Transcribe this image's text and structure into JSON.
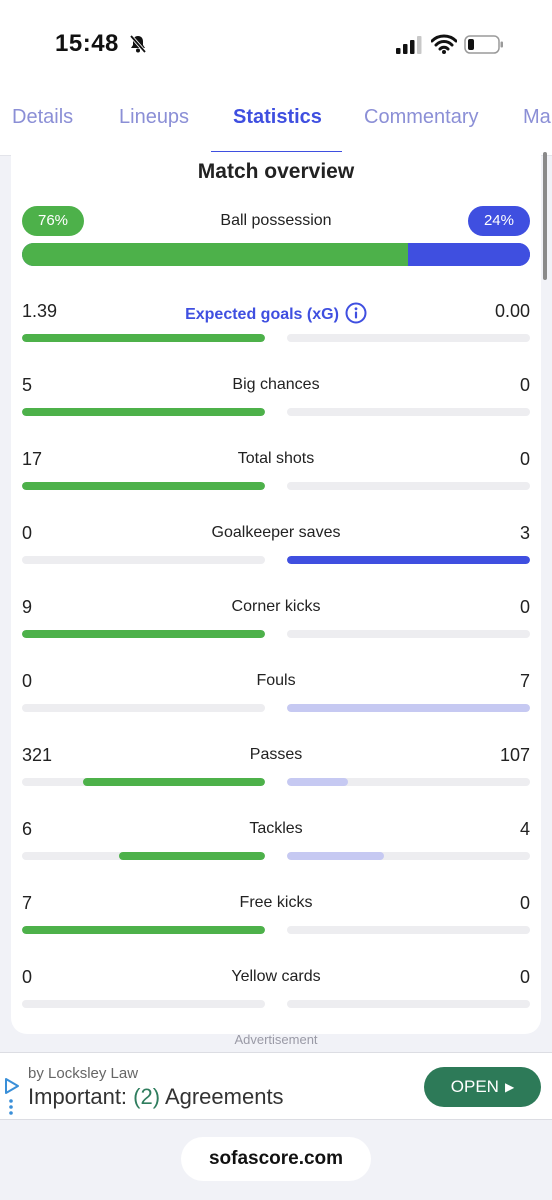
{
  "status_bar": {
    "time": "15:48",
    "bell_icon": "bell-slash-icon",
    "signal_icon": "cellular-signal-icon",
    "wifi_icon": "wifi-icon",
    "battery_icon": "battery-low-icon"
  },
  "tabs": [
    {
      "label": "Details",
      "active": false
    },
    {
      "label": "Lineups",
      "active": false
    },
    {
      "label": "Statistics",
      "active": true
    },
    {
      "label": "Commentary",
      "active": false
    },
    {
      "label": "Ma",
      "active": false
    }
  ],
  "card": {
    "title": "Match overview",
    "possession": {
      "label": "Ball possession",
      "home": "76%",
      "away": "24%",
      "home_value": 76,
      "away_value": 24
    },
    "stats": [
      {
        "label": "Expected goals (xG)",
        "home": "1.39",
        "away": "0.00",
        "home_fill": 1.0,
        "away_fill": 0.0,
        "away_style": "weak",
        "info": true
      },
      {
        "label": "Big chances",
        "home": "5",
        "away": "0",
        "home_fill": 1.0,
        "away_fill": 0.0,
        "away_style": "weak"
      },
      {
        "label": "Total shots",
        "home": "17",
        "away": "0",
        "home_fill": 1.0,
        "away_fill": 0.0,
        "away_style": "weak"
      },
      {
        "label": "Goalkeeper saves",
        "home": "0",
        "away": "3",
        "home_fill": 0.0,
        "away_fill": 1.0,
        "away_style": "strong"
      },
      {
        "label": "Corner kicks",
        "home": "9",
        "away": "0",
        "home_fill": 1.0,
        "away_fill": 0.0,
        "away_style": "weak"
      },
      {
        "label": "Fouls",
        "home": "0",
        "away": "7",
        "home_fill": 0.0,
        "away_fill": 1.0,
        "away_style": "weak"
      },
      {
        "label": "Passes",
        "home": "321",
        "away": "107",
        "home_fill": 0.75,
        "away_fill": 0.25,
        "away_style": "weak"
      },
      {
        "label": "Tackles",
        "home": "6",
        "away": "4",
        "home_fill": 0.6,
        "away_fill": 0.4,
        "away_style": "weak"
      },
      {
        "label": "Free kicks",
        "home": "7",
        "away": "0",
        "home_fill": 1.0,
        "away_fill": 0.0,
        "away_style": "weak"
      },
      {
        "label": "Yellow cards",
        "home": "0",
        "away": "0",
        "home_fill": 0.0,
        "away_fill": 0.0,
        "away_style": "weak"
      }
    ]
  },
  "ad": {
    "label": "Advertisement",
    "by": "by Locksley Law",
    "headline_pre": "Important: ",
    "headline_accent": "(2)",
    "headline_post": " Agreements",
    "open_label": "OPEN"
  },
  "footer": {
    "domain": "sofascore.com"
  },
  "colors": {
    "home": "#4db14a",
    "away": "#3f4fe0",
    "away_light": "#c6c9f2",
    "track": "#ededf0",
    "ad_button": "#2d7a58"
  }
}
